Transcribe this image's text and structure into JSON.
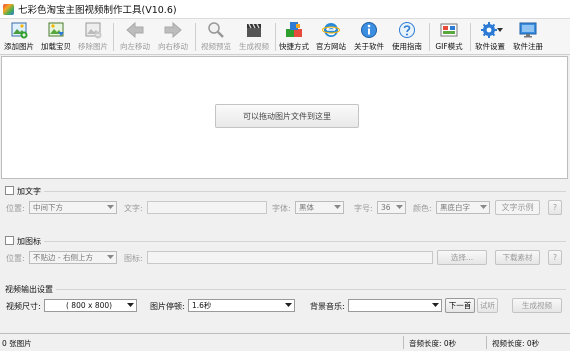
{
  "window": {
    "title": "七彩色淘宝主图视频制作工具(V10.6)"
  },
  "toolbar": {
    "add_image": "添加图片",
    "load_item": "加载宝贝",
    "remove_image": "移除图片",
    "move_left": "向左移动",
    "move_right": "向右移动",
    "video_preview": "视频预览",
    "generate_video": "生成视频",
    "shortcut": "快捷方式",
    "official_site": "官方网站",
    "about": "关于软件",
    "guide": "使用指南",
    "gif_mode": "GIF模式",
    "settings": "软件设置",
    "register": "软件注册"
  },
  "dropzone": {
    "hint": "可以拖动图片文件到这里"
  },
  "text_panel": {
    "enable_label": "加文字",
    "position_label": "位置:",
    "position_value": "中间下方",
    "text_label": "文字:",
    "font_label": "字体:",
    "font_value": "黑体",
    "size_label": "字号:",
    "size_value": "36",
    "color_label": "颜色:",
    "color_value": "黑底白字",
    "sample_label": "文字示例",
    "help_label": "?"
  },
  "logo_panel": {
    "enable_label": "加图标",
    "position_label": "位置:",
    "position_value": "不贴边 - 右侧上方",
    "icon_label": "图标:",
    "choose_label": "选择...",
    "download_label": "下载素材",
    "help_label": "?"
  },
  "output_panel": {
    "title": "视频输出设置",
    "size_label": "视频尺寸:",
    "size_value": "( 800 x 800)",
    "pause_label": "图片停顿:",
    "pause_value": "1.6秒",
    "music_label": "背景音乐:",
    "music_value": "",
    "next_label": "下一首",
    "listen_label": "试听",
    "generate_label": "生成视频"
  },
  "status": {
    "image_count": "0 张图片",
    "audio_length": "音频长度: 0秒",
    "video_length": "视频长度: 0秒"
  },
  "colors": {
    "accent_blue": "#2e7bd6",
    "panel_bg": "#f0f0f0",
    "disabled_text": "#9a9a9a"
  }
}
